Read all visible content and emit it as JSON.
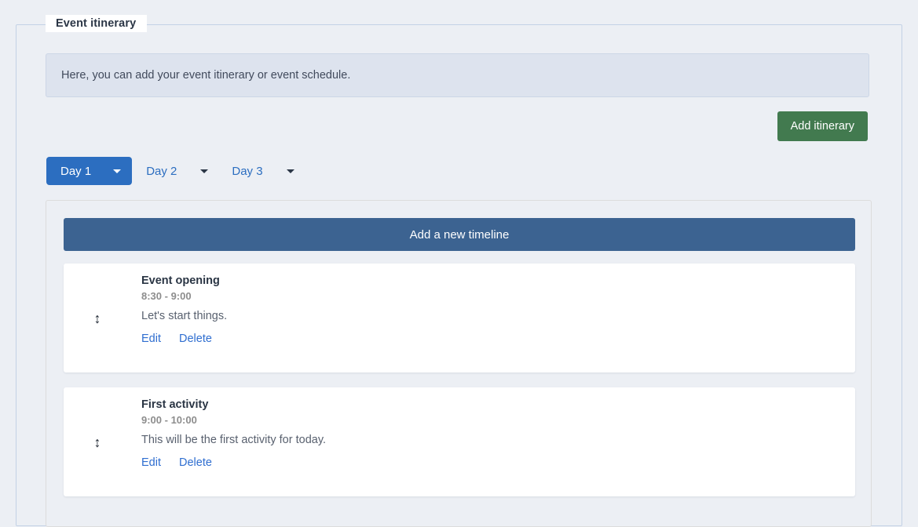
{
  "page": {
    "background_color": "#eceff4"
  },
  "fieldset": {
    "legend": "Event itinerary"
  },
  "alert": {
    "text": "Here, you can add your event itinerary or event schedule.",
    "background_color": "#dde3ee",
    "border_color": "#ccd6e6"
  },
  "toolbar": {
    "add_itinerary_label": "Add itinerary",
    "add_itinerary_color": "#427a4f"
  },
  "day_tabs": {
    "active_color": "#2c6ec0",
    "items": [
      {
        "label": "Day 1",
        "active": true,
        "caret": "chevron-down-icon"
      },
      {
        "label": "Day 2",
        "active": false,
        "caret": "chevron-down-icon"
      },
      {
        "label": "Day 3",
        "active": false,
        "caret": "chevron-down-icon"
      }
    ]
  },
  "panel": {
    "add_timeline_label": "Add a new timeline",
    "add_timeline_color": "#3c6391",
    "cards": [
      {
        "drag_handle_icon": "up-down-arrow-icon",
        "title": "Event opening",
        "time": "8:30 - 9:00",
        "description": "Let's start things.",
        "edit_label": "Edit",
        "delete_label": "Delete"
      },
      {
        "drag_handle_icon": "up-down-arrow-icon",
        "title": "First activity",
        "time": "9:00 - 10:00",
        "description": "This will be the first activity for today.",
        "edit_label": "Edit",
        "delete_label": "Delete"
      }
    ]
  }
}
